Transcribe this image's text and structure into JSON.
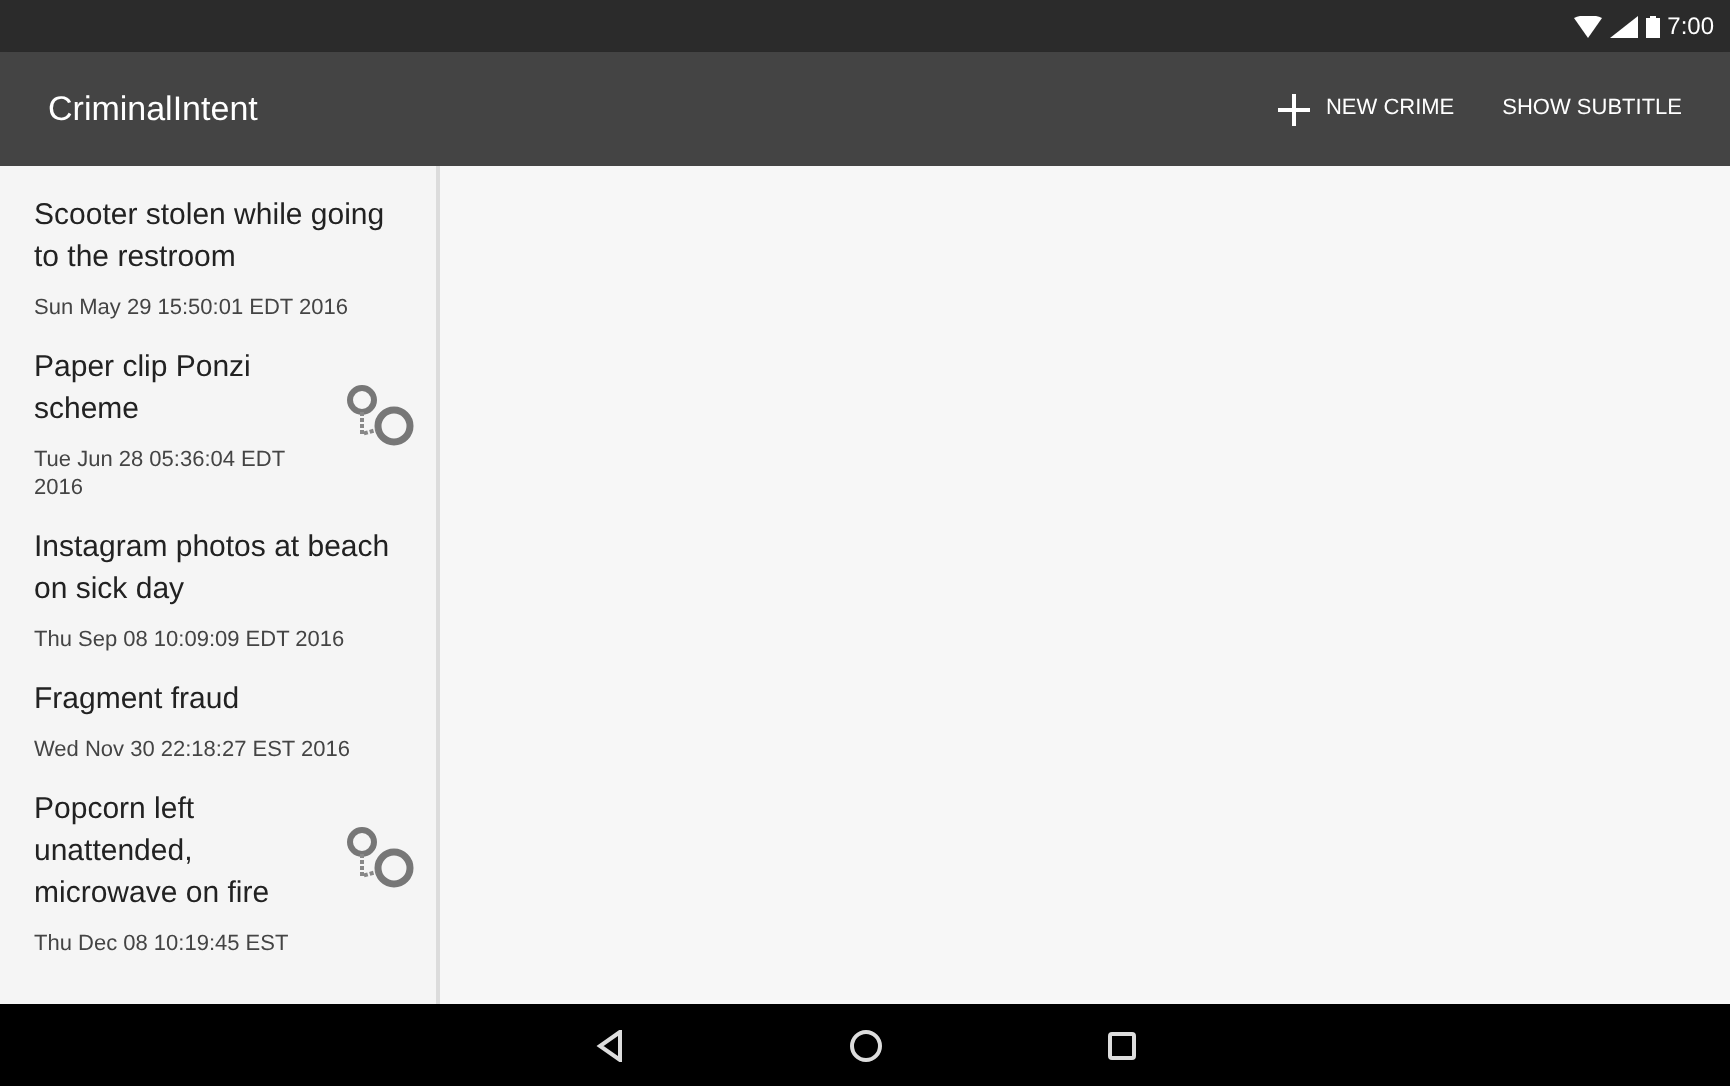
{
  "status_bar": {
    "time": "7:00"
  },
  "toolbar": {
    "title": "CriminalIntent",
    "actions": [
      {
        "kind": "add",
        "label": "NEW CRIME"
      },
      {
        "kind": "text",
        "label": "SHOW SUBTITLE"
      }
    ]
  },
  "crimes": [
    {
      "title": "Scooter stolen while going to the restroom",
      "date": "Sun May 29 15:50:01 EDT 2016",
      "solved": false
    },
    {
      "title": "Paper clip Ponzi scheme",
      "date": "Tue Jun 28 05:36:04 EDT 2016",
      "solved": true
    },
    {
      "title": "Instagram photos at beach on sick day",
      "date": "Thu Sep 08 10:09:09 EDT 2016",
      "solved": false
    },
    {
      "title": "Fragment fraud",
      "date": "Wed Nov 30 22:18:27 EST 2016",
      "solved": false
    },
    {
      "title": "Popcorn left unattended, microwave on fire",
      "date": "Thu Dec 08 10:19:45 EST",
      "solved": true
    }
  ]
}
